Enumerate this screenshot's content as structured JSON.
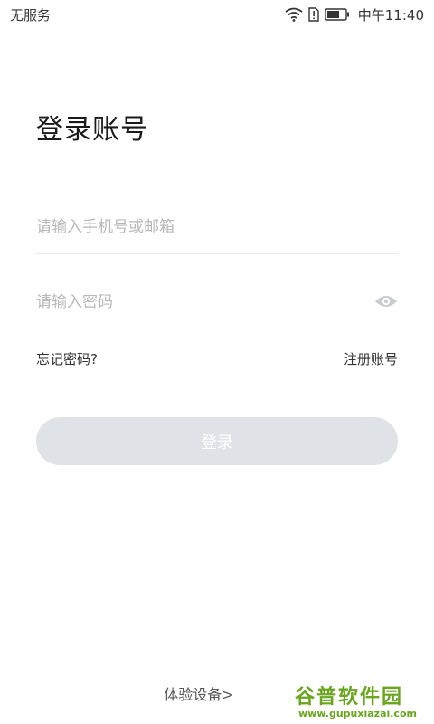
{
  "status_bar": {
    "carrier": "无服务",
    "time": "中午11:40",
    "icons": [
      "wifi-icon",
      "sim-alert-icon",
      "battery-icon"
    ]
  },
  "login": {
    "title": "登录账号",
    "phone_placeholder": "请输入手机号或邮箱",
    "password_placeholder": "请输入密码",
    "forgot_label": "忘记密码?",
    "register_label": "注册账号",
    "submit_label": "登录",
    "trial_label": "体验设备>"
  },
  "watermark": {
    "top": "谷普软件园",
    "bottom": "www.gupuxiazai.com"
  },
  "colors": {
    "button_disabled": "#dfe2e6",
    "watermark_green": "#6aa51e",
    "placeholder": "#b8b8b8"
  }
}
